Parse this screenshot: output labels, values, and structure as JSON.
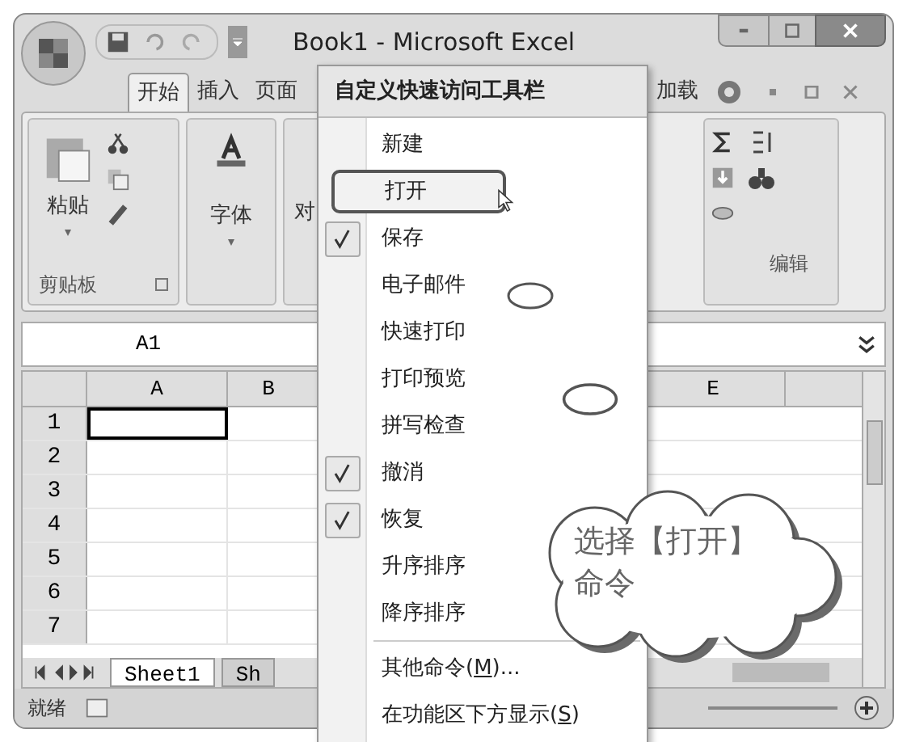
{
  "window": {
    "title": "Book1 - Microsoft Excel"
  },
  "ribbon_tabs": [
    {
      "label": "开始",
      "selected": true
    },
    {
      "label": "插入",
      "selected": false
    },
    {
      "label": "页面",
      "selected": false
    },
    {
      "label": "加载",
      "selected": false
    }
  ],
  "ribbon": {
    "paste": "粘贴",
    "clipboard_group": "剪贴板",
    "font_group": "字体",
    "align_group": "对",
    "editing_group": "编辑"
  },
  "name_box": "A1",
  "columns": [
    "A",
    "B",
    "E"
  ],
  "rows": [
    "1",
    "2",
    "3",
    "4",
    "5",
    "6",
    "7"
  ],
  "sheet_tabs": [
    {
      "label": "Sheet1",
      "selected": true
    },
    {
      "label": "Sh",
      "selected": false
    }
  ],
  "status_bar": {
    "text": "就绪"
  },
  "menu": {
    "title": "自定义快速访问工具栏",
    "items": [
      {
        "label": "新建",
        "divider": false,
        "checked": false,
        "selected": false
      },
      {
        "label": "打开",
        "divider": false,
        "checked": false,
        "selected": true
      },
      {
        "label": "保存",
        "divider": false,
        "checked": true,
        "selected": false
      },
      {
        "label": "电子邮件",
        "divider": false,
        "checked": false,
        "selected": false
      },
      {
        "label": "快速打印",
        "divider": false,
        "checked": false,
        "selected": false
      },
      {
        "label": "打印预览",
        "divider": false,
        "checked": false,
        "selected": false
      },
      {
        "label": "拼写检查",
        "divider": false,
        "checked": false,
        "selected": false
      },
      {
        "label": "撤消",
        "divider": false,
        "checked": true,
        "selected": false
      },
      {
        "label": "恢复",
        "divider": false,
        "checked": true,
        "selected": false
      },
      {
        "label": "升序排序",
        "divider": false,
        "checked": false,
        "selected": false
      },
      {
        "label": "降序排序",
        "divider": false,
        "checked": false,
        "selected": false
      },
      {
        "label": "其他命令(",
        "accelerator": "M",
        "after": ")...",
        "divider": true,
        "checked": false,
        "selected": false
      },
      {
        "label": "在功能区下方显示(",
        "accelerator": "S",
        "after": ")",
        "divider": false,
        "checked": false,
        "selected": false
      }
    ]
  },
  "callout": "选择【打开】命令"
}
